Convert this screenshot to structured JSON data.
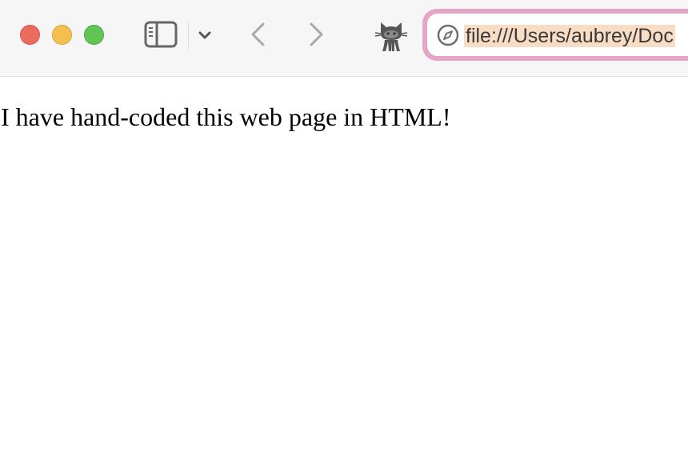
{
  "window": {
    "controls": [
      "close",
      "minimize",
      "zoom"
    ]
  },
  "toolbar": {
    "icons": [
      "sidebar-icon",
      "chevron-down-icon",
      "back-arrow-icon",
      "forward-arrow-icon",
      "github-octocat-icon",
      "compass-icon"
    ],
    "address_bar": {
      "url": "file:///Users/aubrey/Doc",
      "highlight_color": "#e4a6c7"
    }
  },
  "page": {
    "body_text": "I have hand-coded this web page in HTML!"
  }
}
